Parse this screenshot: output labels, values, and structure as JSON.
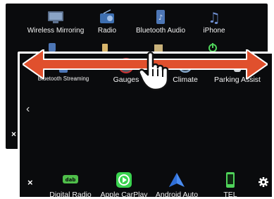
{
  "back_screen": {
    "apps": [
      {
        "label": "Wireless Mirroring",
        "icon": "wireless-mirroring-icon"
      },
      {
        "label": "Radio",
        "icon": "radio-icon"
      },
      {
        "label": "Bluetooth Audio",
        "icon": "bluetooth-audio-icon"
      },
      {
        "label": "iPhone",
        "icon": "iphone-music-icon"
      }
    ],
    "close_glyph": "×"
  },
  "front_screen": {
    "apps": [
      {
        "label": "Bluetooth Streaming",
        "icon": "bluetooth-streaming-icon"
      },
      {
        "label": "Gauges",
        "icon": "gauges-icon"
      },
      {
        "label": "Climate",
        "icon": "climate-icon"
      },
      {
        "label": "Parking Assist",
        "icon": "parking-assist-icon"
      }
    ],
    "back_chevron": "‹",
    "dock": [
      {
        "label": "Digital Radio",
        "icon": "digital-radio-icon"
      },
      {
        "label": "Apple CarPlay",
        "icon": "apple-carplay-icon"
      },
      {
        "label": "Android Auto",
        "icon": "android-auto-icon"
      },
      {
        "label": "TEL",
        "icon": "tel-icon"
      }
    ],
    "close_glyph": "×"
  },
  "colors": {
    "arrow": "#e0502d",
    "carplay": "#3ad34f",
    "android_auto": "#4a8cf0",
    "tel": "#4fd45a",
    "background": "#0a0b0d"
  }
}
